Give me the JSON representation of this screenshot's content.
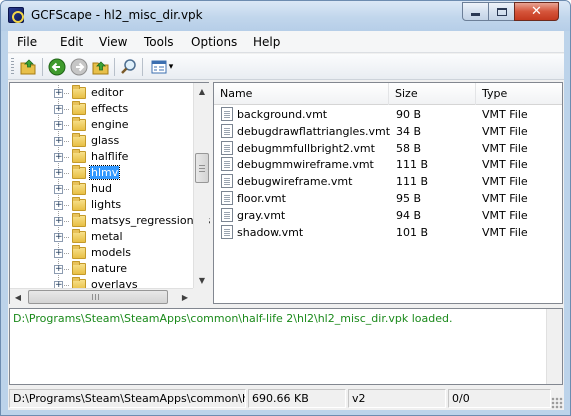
{
  "window": {
    "title": "GCFScape - hl2_misc_dir.vpk"
  },
  "menu": [
    "File",
    "Edit",
    "View",
    "Tools",
    "Options",
    "Help"
  ],
  "toolbar": {
    "buttons": [
      {
        "name": "open-folder-icon"
      },
      {
        "name": "back-arrow-icon"
      },
      {
        "name": "forward-arrow-icon"
      },
      {
        "name": "up-folder-icon"
      },
      {
        "name": "search-icon"
      },
      {
        "name": "view-mode-icon"
      }
    ],
    "dropdown_glyph": "▾"
  },
  "tree": {
    "items": [
      {
        "label": "editor",
        "selected": false
      },
      {
        "label": "effects",
        "selected": false
      },
      {
        "label": "engine",
        "selected": false
      },
      {
        "label": "glass",
        "selected": false
      },
      {
        "label": "halflife",
        "selected": false
      },
      {
        "label": "hlmv",
        "selected": true
      },
      {
        "label": "hud",
        "selected": false
      },
      {
        "label": "lights",
        "selected": false
      },
      {
        "label": "matsys_regressiontes",
        "selected": false
      },
      {
        "label": "metal",
        "selected": false
      },
      {
        "label": "models",
        "selected": false
      },
      {
        "label": "nature",
        "selected": false
      },
      {
        "label": "overlays",
        "selected": false
      }
    ]
  },
  "list": {
    "columns": {
      "name": "Name",
      "size": "Size",
      "type": "Type"
    },
    "rows": [
      {
        "name": "background.vmt",
        "size": "90 B",
        "type": "VMT File"
      },
      {
        "name": "debugdrawflattriangles.vmt",
        "size": "34 B",
        "type": "VMT File"
      },
      {
        "name": "debugmmfullbright2.vmt",
        "size": "58 B",
        "type": "VMT File"
      },
      {
        "name": "debugmmwireframe.vmt",
        "size": "111 B",
        "type": "VMT File"
      },
      {
        "name": "debugwireframe.vmt",
        "size": "111 B",
        "type": "VMT File"
      },
      {
        "name": "floor.vmt",
        "size": "95 B",
        "type": "VMT File"
      },
      {
        "name": "gray.vmt",
        "size": "94 B",
        "type": "VMT File"
      },
      {
        "name": "shadow.vmt",
        "size": "101 B",
        "type": "VMT File"
      }
    ]
  },
  "log": {
    "message": "D:\\Programs\\Steam\\SteamApps\\common\\half-life 2\\hl2\\hl2_misc_dir.vpk loaded."
  },
  "status": {
    "path": "D:\\Programs\\Steam\\SteamApps\\common\\half-life",
    "size": "690.66 KB",
    "version": "v2",
    "count": "0/0"
  },
  "colors": {
    "log_text": "#1b8a1b",
    "selection": "#3399ff",
    "close_button": "#c4391f"
  }
}
